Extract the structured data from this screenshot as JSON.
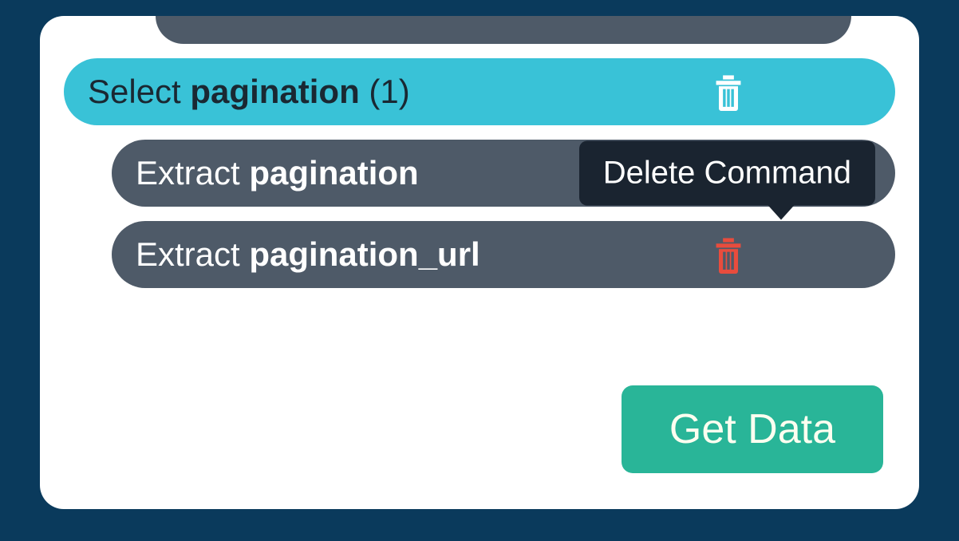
{
  "rows": {
    "select_pagination": {
      "action": "Select",
      "name": "pagination",
      "count": "(1)"
    },
    "extract_pagination": {
      "action": "Extract",
      "name": "pagination"
    },
    "extract_pagination_url": {
      "action": "Extract",
      "name": "pagination_url"
    }
  },
  "tooltip": {
    "delete_command": "Delete Command"
  },
  "buttons": {
    "get_data": "Get Data"
  }
}
